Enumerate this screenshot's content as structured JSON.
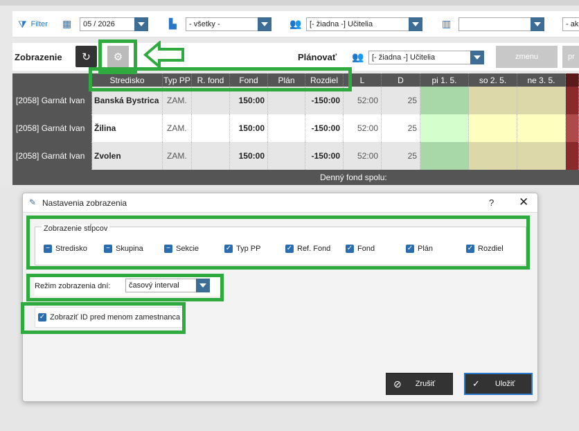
{
  "filterbar": {
    "filter_label": "Filter",
    "month_value": "05 / 2026",
    "type_value": "- všetky -",
    "teachers_value": "[- žiadna -] Učitelia",
    "columns_value": "",
    "last_value": "- ake"
  },
  "toolbar": {
    "zobrazenie_label": "Zobrazenie",
    "planovat_label": "Plánovať",
    "plan_teachers_value": "[- žiadna -] Učitelia",
    "zmenu_label": "zmenu",
    "pr_label": "pr"
  },
  "grid": {
    "headers": [
      "Stredisko",
      "Typ PP",
      "R. fond",
      "Fond",
      "Plán",
      "Rozdiel",
      "L",
      "D",
      "pi 1. 5.",
      "so 2. 5.",
      "ne 3. 5."
    ],
    "rows": [
      {
        "name": "[2058] Garnát Ivan",
        "stredisko": "Banská Bystrica",
        "typ": "ZAM.",
        "rfond": "",
        "fond": "150:00",
        "plan": "",
        "rozdiel": "-150:00",
        "l": "52:00",
        "d": "25"
      },
      {
        "name": "[2058] Garnát Ivan",
        "stredisko": "Žilina",
        "typ": "ZAM.",
        "rfond": "",
        "fond": "150:00",
        "plan": "",
        "rozdiel": "-150:00",
        "l": "52:00",
        "d": "25"
      },
      {
        "name": "[2058] Garnát Ivan",
        "stredisko": "Zvolen",
        "typ": "ZAM.",
        "rfond": "",
        "fond": "150:00",
        "plan": "",
        "rozdiel": "-150:00",
        "l": "52:00",
        "d": "25"
      }
    ],
    "footer_label": "Denný fond spolu:"
  },
  "dialog": {
    "title": "Nastavenia zobrazenia",
    "help": "?",
    "close": "✕",
    "group_legend": "Zobrazenie stĺpcov",
    "checkboxes": [
      {
        "label": "Stredisko",
        "checked": false
      },
      {
        "label": "Skupina",
        "checked": false
      },
      {
        "label": "Sekcie",
        "checked": false
      },
      {
        "label": "Typ PP",
        "checked": true
      },
      {
        "label": "Ref. Fond",
        "checked": true
      },
      {
        "label": "Fond",
        "checked": true
      },
      {
        "label": "Plán",
        "checked": true
      },
      {
        "label": "Rozdiel",
        "checked": true
      }
    ],
    "mode_label": "Režim zobrazenia dní:",
    "mode_value": "časový interval",
    "show_id_label": "Zobraziť ID pred menom zamestnanca",
    "show_id_checked": true,
    "cancel_label": "Zrušiť",
    "save_label": "Uložiť"
  },
  "colors": {
    "accent": "#3d6d95",
    "highlight": "#2eaa3e",
    "cell_green": "#a9d8a8",
    "cell_light_green": "#d4ffcc",
    "cell_olive": "#dcd8aa",
    "cell_yellow": "#fefebf",
    "cell_red": "#8b2a2a"
  }
}
